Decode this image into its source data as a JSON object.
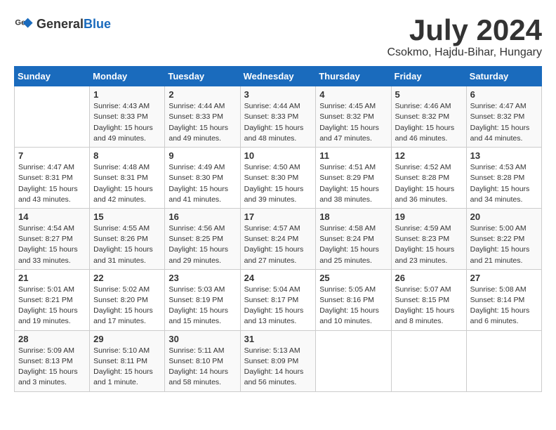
{
  "header": {
    "logo_general": "General",
    "logo_blue": "Blue",
    "month_year": "July 2024",
    "location": "Csokmo, Hajdu-Bihar, Hungary"
  },
  "calendar": {
    "days_of_week": [
      "Sunday",
      "Monday",
      "Tuesday",
      "Wednesday",
      "Thursday",
      "Friday",
      "Saturday"
    ],
    "weeks": [
      [
        {
          "day": "",
          "info": ""
        },
        {
          "day": "1",
          "info": "Sunrise: 4:43 AM\nSunset: 8:33 PM\nDaylight: 15 hours\nand 49 minutes."
        },
        {
          "day": "2",
          "info": "Sunrise: 4:44 AM\nSunset: 8:33 PM\nDaylight: 15 hours\nand 49 minutes."
        },
        {
          "day": "3",
          "info": "Sunrise: 4:44 AM\nSunset: 8:33 PM\nDaylight: 15 hours\nand 48 minutes."
        },
        {
          "day": "4",
          "info": "Sunrise: 4:45 AM\nSunset: 8:32 PM\nDaylight: 15 hours\nand 47 minutes."
        },
        {
          "day": "5",
          "info": "Sunrise: 4:46 AM\nSunset: 8:32 PM\nDaylight: 15 hours\nand 46 minutes."
        },
        {
          "day": "6",
          "info": "Sunrise: 4:47 AM\nSunset: 8:32 PM\nDaylight: 15 hours\nand 44 minutes."
        }
      ],
      [
        {
          "day": "7",
          "info": "Sunrise: 4:47 AM\nSunset: 8:31 PM\nDaylight: 15 hours\nand 43 minutes."
        },
        {
          "day": "8",
          "info": "Sunrise: 4:48 AM\nSunset: 8:31 PM\nDaylight: 15 hours\nand 42 minutes."
        },
        {
          "day": "9",
          "info": "Sunrise: 4:49 AM\nSunset: 8:30 PM\nDaylight: 15 hours\nand 41 minutes."
        },
        {
          "day": "10",
          "info": "Sunrise: 4:50 AM\nSunset: 8:30 PM\nDaylight: 15 hours\nand 39 minutes."
        },
        {
          "day": "11",
          "info": "Sunrise: 4:51 AM\nSunset: 8:29 PM\nDaylight: 15 hours\nand 38 minutes."
        },
        {
          "day": "12",
          "info": "Sunrise: 4:52 AM\nSunset: 8:28 PM\nDaylight: 15 hours\nand 36 minutes."
        },
        {
          "day": "13",
          "info": "Sunrise: 4:53 AM\nSunset: 8:28 PM\nDaylight: 15 hours\nand 34 minutes."
        }
      ],
      [
        {
          "day": "14",
          "info": "Sunrise: 4:54 AM\nSunset: 8:27 PM\nDaylight: 15 hours\nand 33 minutes."
        },
        {
          "day": "15",
          "info": "Sunrise: 4:55 AM\nSunset: 8:26 PM\nDaylight: 15 hours\nand 31 minutes."
        },
        {
          "day": "16",
          "info": "Sunrise: 4:56 AM\nSunset: 8:25 PM\nDaylight: 15 hours\nand 29 minutes."
        },
        {
          "day": "17",
          "info": "Sunrise: 4:57 AM\nSunset: 8:24 PM\nDaylight: 15 hours\nand 27 minutes."
        },
        {
          "day": "18",
          "info": "Sunrise: 4:58 AM\nSunset: 8:24 PM\nDaylight: 15 hours\nand 25 minutes."
        },
        {
          "day": "19",
          "info": "Sunrise: 4:59 AM\nSunset: 8:23 PM\nDaylight: 15 hours\nand 23 minutes."
        },
        {
          "day": "20",
          "info": "Sunrise: 5:00 AM\nSunset: 8:22 PM\nDaylight: 15 hours\nand 21 minutes."
        }
      ],
      [
        {
          "day": "21",
          "info": "Sunrise: 5:01 AM\nSunset: 8:21 PM\nDaylight: 15 hours\nand 19 minutes."
        },
        {
          "day": "22",
          "info": "Sunrise: 5:02 AM\nSunset: 8:20 PM\nDaylight: 15 hours\nand 17 minutes."
        },
        {
          "day": "23",
          "info": "Sunrise: 5:03 AM\nSunset: 8:19 PM\nDaylight: 15 hours\nand 15 minutes."
        },
        {
          "day": "24",
          "info": "Sunrise: 5:04 AM\nSunset: 8:17 PM\nDaylight: 15 hours\nand 13 minutes."
        },
        {
          "day": "25",
          "info": "Sunrise: 5:05 AM\nSunset: 8:16 PM\nDaylight: 15 hours\nand 10 minutes."
        },
        {
          "day": "26",
          "info": "Sunrise: 5:07 AM\nSunset: 8:15 PM\nDaylight: 15 hours\nand 8 minutes."
        },
        {
          "day": "27",
          "info": "Sunrise: 5:08 AM\nSunset: 8:14 PM\nDaylight: 15 hours\nand 6 minutes."
        }
      ],
      [
        {
          "day": "28",
          "info": "Sunrise: 5:09 AM\nSunset: 8:13 PM\nDaylight: 15 hours\nand 3 minutes."
        },
        {
          "day": "29",
          "info": "Sunrise: 5:10 AM\nSunset: 8:11 PM\nDaylight: 15 hours\nand 1 minute."
        },
        {
          "day": "30",
          "info": "Sunrise: 5:11 AM\nSunset: 8:10 PM\nDaylight: 14 hours\nand 58 minutes."
        },
        {
          "day": "31",
          "info": "Sunrise: 5:13 AM\nSunset: 8:09 PM\nDaylight: 14 hours\nand 56 minutes."
        },
        {
          "day": "",
          "info": ""
        },
        {
          "day": "",
          "info": ""
        },
        {
          "day": "",
          "info": ""
        }
      ]
    ]
  }
}
